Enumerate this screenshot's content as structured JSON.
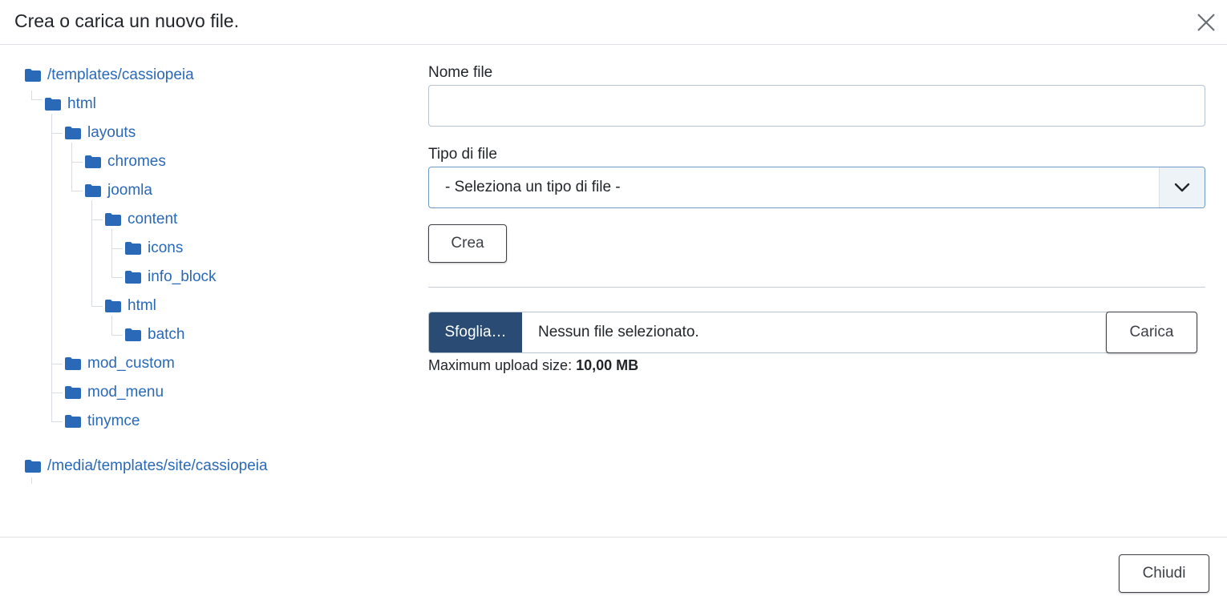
{
  "dialog": {
    "title": "Crea o carica un nuovo file.",
    "close_icon": "close-icon"
  },
  "tree": {
    "folder_icon": "folder-icon",
    "folder_color": "#2a69b8",
    "items": [
      {
        "label": "/templates/cassiopeia"
      },
      {
        "label": "html"
      },
      {
        "label": "layouts"
      },
      {
        "label": "chromes"
      },
      {
        "label": "joomla"
      },
      {
        "label": "content"
      },
      {
        "label": "icons"
      },
      {
        "label": "info_block"
      },
      {
        "label": "html"
      },
      {
        "label": "batch"
      },
      {
        "label": "mod_custom"
      },
      {
        "label": "mod_menu"
      },
      {
        "label": "tinymce"
      },
      {
        "label": "/media/templates/site/cassiopeia"
      }
    ]
  },
  "create_form": {
    "filename_label": "Nome file",
    "filename_value": "",
    "filetype_label": "Tipo di file",
    "filetype_selected": "- Seleziona un tipo di file -",
    "create_button": "Crea"
  },
  "upload_form": {
    "browse_button": "Sfoglia…",
    "file_status": "Nessun file selezionato.",
    "upload_button": "Carica",
    "max_size_label": "Maximum upload size:",
    "max_size_value": "10,00 MB",
    "browse_color": "#2a4b73"
  },
  "footer": {
    "close_button": "Chiudi"
  }
}
